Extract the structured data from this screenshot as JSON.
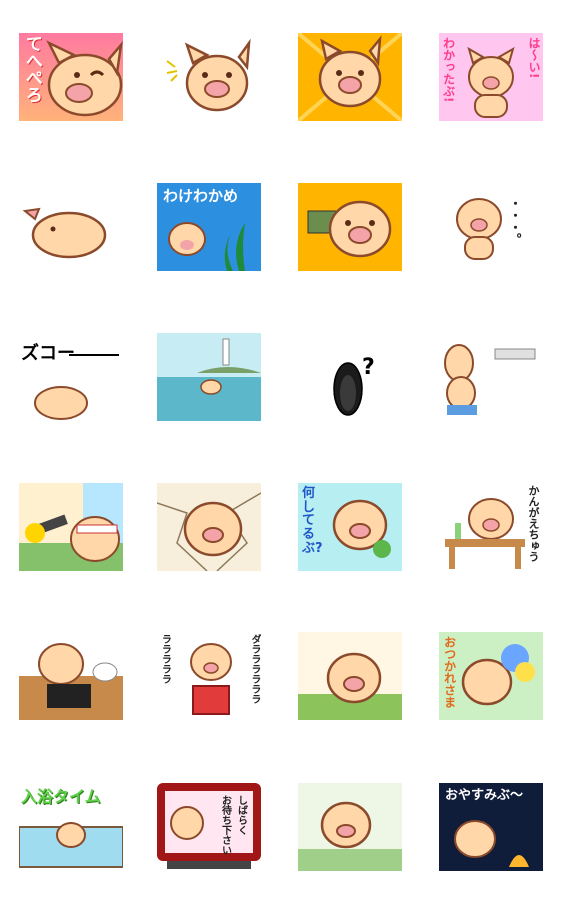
{
  "stickers": [
    {
      "id": "s1",
      "text": "てへぺろ"
    },
    {
      "id": "s2",
      "text": ""
    },
    {
      "id": "s3",
      "text": ""
    },
    {
      "id": "s4",
      "text_a": "は〜い!",
      "text_b": "わかったぶ!"
    },
    {
      "id": "s5",
      "text": ""
    },
    {
      "id": "s6",
      "text": "わけわかめ"
    },
    {
      "id": "s7",
      "text": ""
    },
    {
      "id": "s8",
      "text": "・・・。"
    },
    {
      "id": "s9",
      "text": "ズコー"
    },
    {
      "id": "s10",
      "text": ""
    },
    {
      "id": "s11",
      "text": "?"
    },
    {
      "id": "s12",
      "text": ""
    },
    {
      "id": "s13",
      "text": ""
    },
    {
      "id": "s14",
      "text": ""
    },
    {
      "id": "s15",
      "text": "何してるぶ?"
    },
    {
      "id": "s16",
      "text": "かんがえちゅう"
    },
    {
      "id": "s17",
      "text": ""
    },
    {
      "id": "s18",
      "text_a": "ラララララ",
      "text_b": "ダララララララ"
    },
    {
      "id": "s19",
      "text": ""
    },
    {
      "id": "s20",
      "text": "おつかれさま"
    },
    {
      "id": "s21",
      "text": "入浴タイム"
    },
    {
      "id": "s22",
      "text_a": "しばらく",
      "text_b": "お待ち下さい"
    },
    {
      "id": "s23",
      "text": ""
    },
    {
      "id": "s24",
      "text": "おやすみぶ〜"
    }
  ],
  "colors": {
    "pig_body": "#ffd7a8",
    "pig_outline": "#8b4a2b",
    "pig_snout": "#f4a3a8",
    "pig_cheek": "#ff9a9a"
  }
}
